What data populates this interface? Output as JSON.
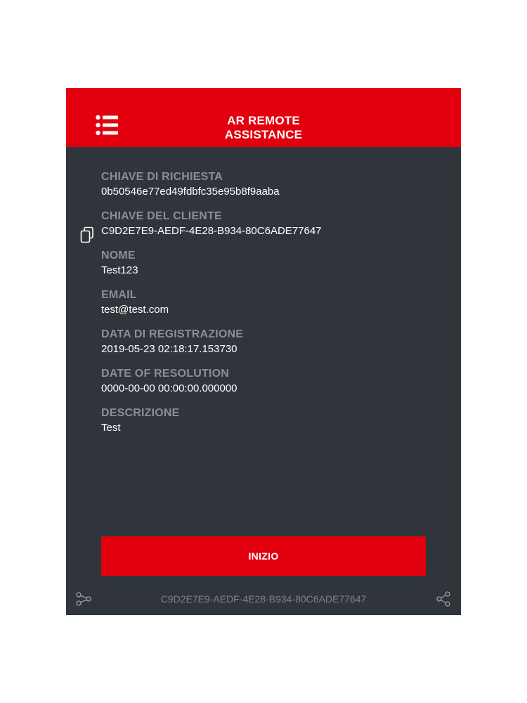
{
  "header": {
    "title_line1": "AR REMOTE",
    "title_line2": "ASSISTANCE",
    "menu_icon": "menu-list-icon"
  },
  "fields": [
    {
      "label": "CHIAVE DI RICHIESTA",
      "value": "0b50546e77ed49fdbfc35e95b8f9aaba"
    },
    {
      "label": "CHIAVE DEL CLIENTE",
      "value": "C9D2E7E9-AEDF-4E28-B934-80C6ADE77647",
      "icon": "copy-icon"
    },
    {
      "label": "NOME",
      "value": "Test123"
    },
    {
      "label": "EMAIL",
      "value": "test@test.com"
    },
    {
      "label": "DATA DI REGISTRAZIONE",
      "value": "2019-05-23 02:18:17.153730"
    },
    {
      "label": "DATE OF RESOLUTION",
      "value": "0000-00-00 00:00:00.000000"
    },
    {
      "label": "DESCRIZIONE",
      "value": "Test"
    }
  ],
  "start_button": {
    "label": "INIZIO"
  },
  "footer": {
    "client_id": "C9D2E7E9-AEDF-4E28-B934-80C6ADE77647",
    "left_icon": "connect-icon",
    "right_icon": "share-icon"
  },
  "colors": {
    "accent": "#e2000f",
    "background": "#2f353b",
    "label": "#8b8f93",
    "value": "#ffffff",
    "footer_text": "#7d8287"
  }
}
